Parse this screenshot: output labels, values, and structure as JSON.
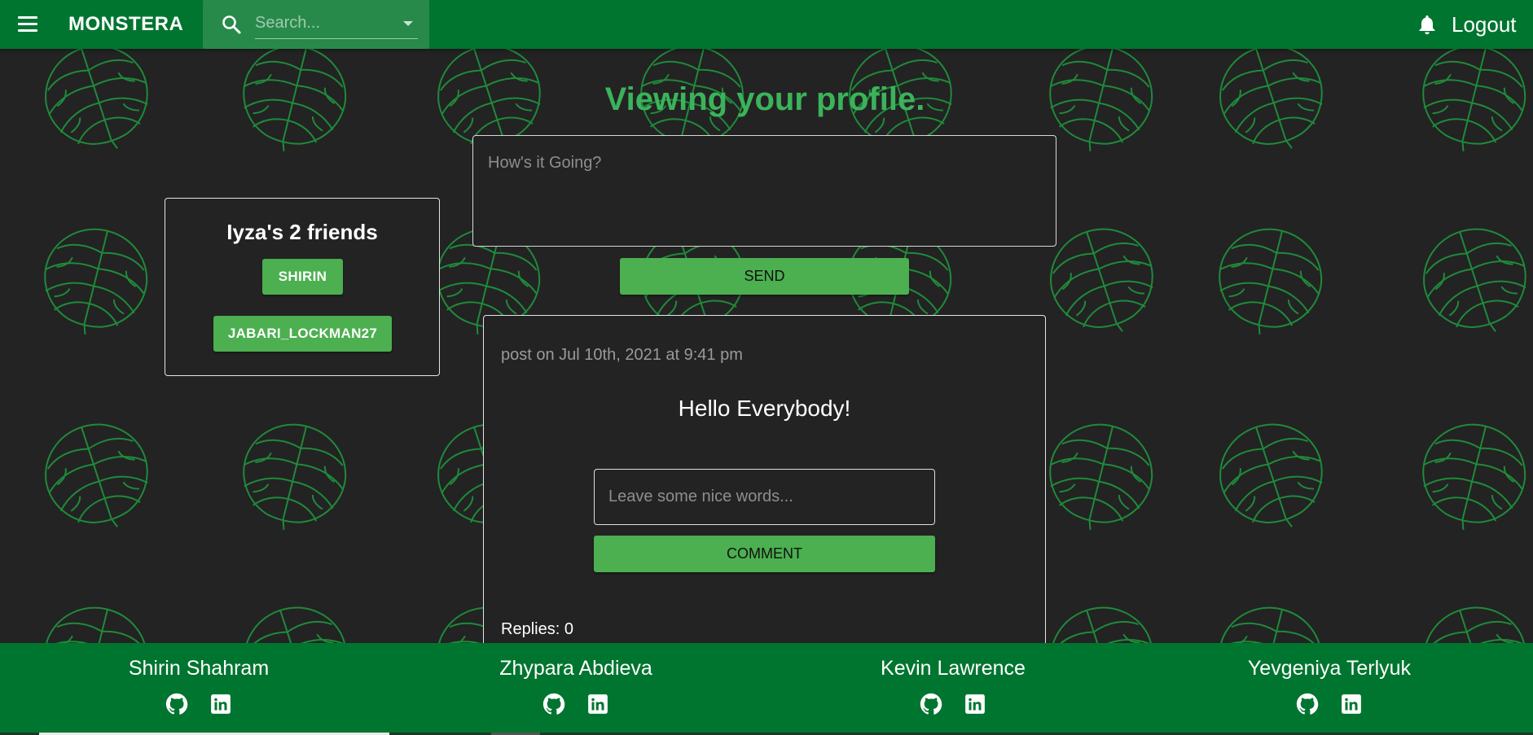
{
  "header": {
    "brand": "MONSTERA",
    "search_placeholder": "Search...",
    "logout_label": "Logout"
  },
  "page": {
    "title": "Viewing your profile."
  },
  "friends": {
    "title": "Iyza's 2 friends",
    "items": [
      "SHIRIN",
      "JABARI_LOCKMAN27"
    ]
  },
  "compose": {
    "placeholder": "How's it Going?",
    "send_label": "SEND"
  },
  "post": {
    "meta": "post on Jul 10th, 2021 at 9:41 pm",
    "body": "Hello Everybody!",
    "comment_placeholder": "Leave some nice words...",
    "comment_label": "COMMENT",
    "replies": "Replies: 0"
  },
  "footer": {
    "members": [
      {
        "name": "Shirin Shahram"
      },
      {
        "name": "Zhypara Abdieva"
      },
      {
        "name": "Kevin Lawrence"
      },
      {
        "name": "Yevgeniya Terlyuk"
      }
    ]
  },
  "icons": {
    "menu": "menu-icon",
    "search": "search-icon",
    "dropdown": "chevron-down-icon",
    "notifications": "bell-icon",
    "github": "github-icon",
    "linkedin": "linkedin-icon",
    "background": "monstera-leaf-icon"
  },
  "colors": {
    "appbar": "#00752f",
    "accent": "#4caf50",
    "title": "#3bb35a",
    "background": "#232323",
    "leaf_outline": "#1f8a3a"
  }
}
